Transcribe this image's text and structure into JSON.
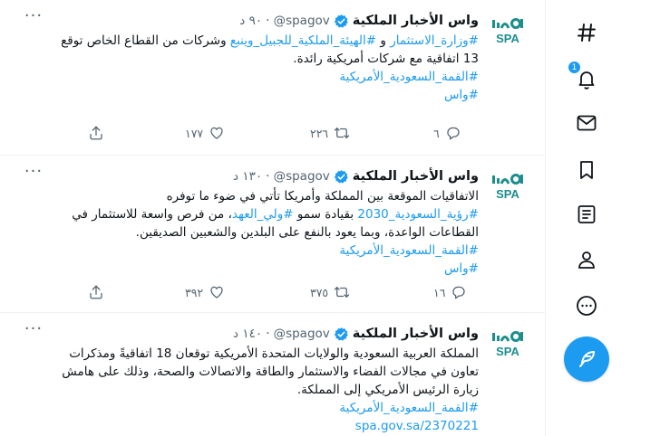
{
  "colors": {
    "accent": "#1d9bf0",
    "text": "#0f1419",
    "muted": "#536471",
    "logo": "#1c8e8e"
  },
  "logo_text": "SPA",
  "tweets": [
    {
      "name": "واس الأخبار الملكية",
      "handle": "@spagov",
      "time": "٩٠ د",
      "lines": [
        [
          {
            "t": "#وزارة_الاستثمار",
            "link": true
          },
          {
            "t": " و ",
            "link": false
          },
          {
            "t": "#الهيئة_الملكية_للجبيل_وينبع",
            "link": true
          },
          {
            "t": " وشركات من القطاع الخاص توقع",
            "link": false
          }
        ],
        [
          {
            "t": "13 اتفاقية مع شركات أمريكية رائدة.",
            "link": false
          }
        ],
        [
          {
            "t": "#القمة_السعودية_الأمريكية",
            "link": true
          }
        ],
        [
          {
            "t": "#واس",
            "link": true
          }
        ]
      ],
      "replies": "٦",
      "retweets": "٢٢٦",
      "likes": "١٧٧"
    },
    {
      "name": "واس الأخبار الملكية",
      "handle": "@spagov",
      "time": "١٣٠ د",
      "lines": [
        [
          {
            "t": "الاتفاقيات الموقعة بين المملكة وأمريكا تأتي في ضوء ما توفره",
            "link": false
          }
        ],
        [
          {
            "t": "#رؤية_السعودية_2030",
            "link": true
          },
          {
            "t": " بقيادة سمو ",
            "link": false
          },
          {
            "t": "#ولي_العهد",
            "link": true
          },
          {
            "t": "، من فرص واسعة للاستثمار في",
            "link": false
          }
        ],
        [
          {
            "t": "القطاعات الواعدة، وبما يعود بالنفع على البلدين والشعبين الصديقين.",
            "link": false
          }
        ],
        [
          {
            "t": "#القمة_السعودية_الأمريكية",
            "link": true
          }
        ],
        [
          {
            "t": "#واس",
            "link": true
          }
        ]
      ],
      "replies": "١٦",
      "retweets": "٣٧٥",
      "likes": "٣٩٢"
    },
    {
      "name": "واس الأخبار الملكية",
      "handle": "@spagov",
      "time": "١٤٠ د",
      "lines": [
        [
          {
            "t": "المملكة العربية السعودية والولايات المتحدة الأمريكية توقعان 18 اتفاقيةً ومذكرات",
            "link": false
          }
        ],
        [
          {
            "t": "تعاون في مجالات الفضاء والاستثمار والطاقة والاتصالات والصحة، وذلك على هامش",
            "link": false
          }
        ],
        [
          {
            "t": "زيارة الرئيس الأمريكي إلى المملكة.",
            "link": false
          }
        ],
        [
          {
            "t": "#القمة_السعودية_الأمريكية",
            "link": true
          }
        ],
        [
          {
            "t": "spa.gov.sa/2370221",
            "link": true
          }
        ]
      ],
      "replies": "",
      "retweets": "",
      "likes": ""
    }
  ],
  "sidebar": {
    "items": [
      {
        "name": "explore",
        "icon": "hashtag-icon"
      },
      {
        "name": "notifications",
        "icon": "bell-icon",
        "badge": "1"
      },
      {
        "name": "messages",
        "icon": "mail-icon"
      },
      {
        "name": "bookmarks",
        "icon": "bookmark-icon"
      },
      {
        "name": "lists",
        "icon": "list-icon"
      },
      {
        "name": "profile",
        "icon": "person-icon"
      },
      {
        "name": "more",
        "icon": "more-circle-icon"
      }
    ],
    "compose_icon": "feather-icon"
  }
}
